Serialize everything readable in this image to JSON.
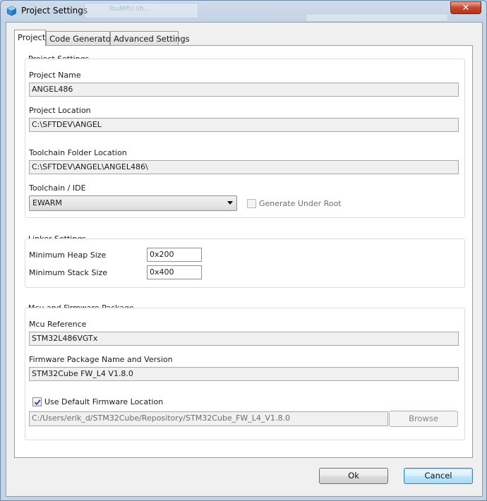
{
  "window": {
    "title": "Project Settings",
    "close_label": "✕",
    "background_ghosts": [
      "TouMPU (ib..."
    ]
  },
  "tabs": [
    {
      "label": "Project",
      "active": true
    },
    {
      "label": "Code Generator",
      "active": false
    },
    {
      "label": "Advanced Settings",
      "active": false
    }
  ],
  "project_settings": {
    "group_title": "Project Settings",
    "project_name_label": "Project Name",
    "project_name_value": "ANGEL486",
    "project_location_label": "Project Location",
    "project_location_value": "C:\\SFTDEV\\ANGEL",
    "toolchain_folder_label": "Toolchain Folder Location",
    "toolchain_folder_value": "C:\\SFTDEV\\ANGEL\\ANGEL486\\",
    "toolchain_ide_label": "Toolchain / IDE",
    "toolchain_ide_value": "EWARM",
    "generate_under_root_label": "Generate Under Root",
    "generate_under_root_checked": false
  },
  "linker_settings": {
    "group_title": "Linker Settings",
    "min_heap_label": "Minimum Heap Size",
    "min_heap_value": "0x200",
    "min_stack_label": "Minimum Stack Size",
    "min_stack_value": "0x400"
  },
  "mcu_firmware": {
    "group_title": "Mcu and Firmware Package",
    "mcu_reference_label": "Mcu Reference",
    "mcu_reference_value": "STM32L486VGTx",
    "firmware_package_label": "Firmware Package Name and Version",
    "firmware_package_value": "STM32Cube FW_L4 V1.8.0",
    "use_default_location_label": "Use Default Firmware Location",
    "use_default_location_checked": true,
    "firmware_location_value": "C:/Users/erik_d/STM32Cube/Repository/STM32Cube_FW_L4_V1.8.0",
    "browse_label": "Browse"
  },
  "footer": {
    "ok_label": "Ok",
    "cancel_label": "Cancel"
  },
  "colors": {
    "accent_default_button": "#3c7fb1",
    "close_button": "#c7452c",
    "title_bar": "#c3d3e6"
  }
}
